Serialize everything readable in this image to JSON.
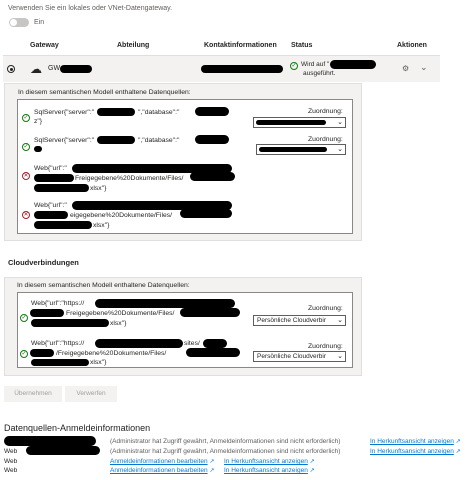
{
  "gateway_intro": "Verwenden Sie ein lokales oder VNet-Datengateway.",
  "toggle_label": "Ein",
  "table_headers": {
    "gateway": "Gateway",
    "department": "Abteilung",
    "contact": "Kontaktinformationen",
    "status": "Status",
    "actions": "Aktionen"
  },
  "gateway_row": {
    "name": "GW",
    "status_line1": "Wird auf \"",
    "status_line2": "ausgeführt."
  },
  "onprem_panel": {
    "title": "In diesem semantischen Modell enthaltene Datenquellen:",
    "mapping_label": "Zuordnung:",
    "sources": [
      {
        "line1": "SqlServer{\"server\":\"",
        "line1b": "\",\"database\":\"",
        "line2": "z\"}",
        "status": "ok"
      },
      {
        "line1": "SqlServer{\"server\":\"",
        "line1b": "\",\"database\":\"",
        "line2": "",
        "status": "ok"
      },
      {
        "line1": "Web{\"url\":\"",
        "line2": "Freigegebene%20Dokumente/Files/",
        "line3": "xlsx\"}",
        "status": "error"
      },
      {
        "line1": "Web{\"url\":\"",
        "line2": "eigegebene%20Dokumente/Files/",
        "line3": "xlsx\"}",
        "status": "error"
      }
    ]
  },
  "cloud_section_title": "Cloudverbindungen",
  "cloud_panel": {
    "title": "In diesem semantischen Modell enthaltene Datenquellen:",
    "mapping_label": "Zuordnung:",
    "selected_value": "Persönliche Cloudverbir",
    "sources": [
      {
        "line1": "Web{\"url\":\"https://",
        "line2": "Freigegebene%20Dokumente/Files/",
        "line3": "xlsx\"}"
      },
      {
        "line1": "Web{\"url\":\"https://",
        "line1b": "sites/",
        "line2": "/Freigegebene%20Dokumente/Files/",
        "line3": "xlsx\"}"
      }
    ]
  },
  "buttons": {
    "apply": "Übernehmen",
    "discard": "Verwerfen"
  },
  "credentials": {
    "title": "Datenquellen-Anmeldeinformationen",
    "rows": [
      {
        "type": "",
        "note": "(Administrator hat Zugriff gewährt, Anmeldeinformationen sind nicht erforderlich)",
        "link": "In Herkunftsansicht anzeigen"
      },
      {
        "type": "Web",
        "note": "(Administrator hat Zugriff gewährt, Anmeldeinformationen sind nicht erforderlich)",
        "link": "In Herkunftsansicht anzeigen"
      },
      {
        "type": "Web",
        "edit": "Anmeldeinformationen bearbeiten",
        "link": "In Herkunftsansicht anzeigen"
      },
      {
        "type": "Web",
        "edit": "Anmeldeinformationen bearbeiten",
        "link": "In Herkunftsansicht anzeigen"
      }
    ]
  },
  "colors": {
    "ok": "#107c10",
    "error": "#a4262c",
    "link": "#0078d4"
  },
  "icons": {
    "ok": "✓",
    "error": "✕",
    "gear": "⚙",
    "chevron": "⌄",
    "external": "↗",
    "cloud": "☁"
  }
}
